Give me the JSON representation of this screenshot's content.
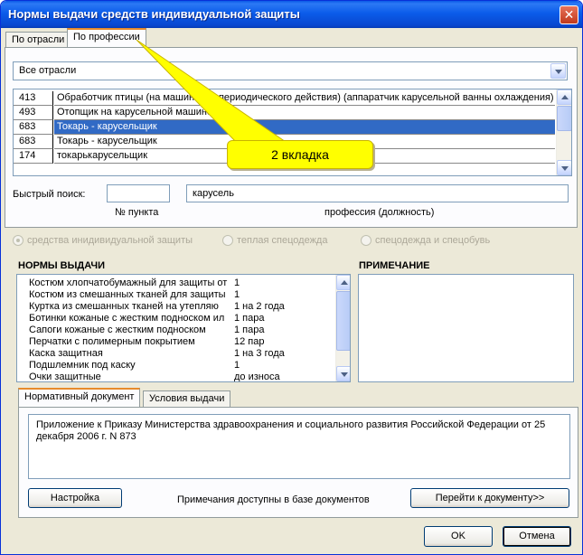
{
  "window": {
    "title": "Нормы выдачи средств индивидуальной защиты",
    "close_glyph": "✕"
  },
  "tabs": {
    "items": [
      {
        "label": "По отрасли"
      },
      {
        "label": "По профессии"
      }
    ]
  },
  "industry_select": {
    "value": "Все отрасли"
  },
  "professions": [
    {
      "code": "413",
      "name": "Обработчик птицы (на машинах непериодического действия) (аппаратчик карусельной ванны охлаждения)"
    },
    {
      "code": "493",
      "name": "Отопщик на карусельной машине"
    },
    {
      "code": "683",
      "name": "Токарь - карусельщик"
    },
    {
      "code": "683",
      "name": "Токарь - карусельщик"
    },
    {
      "code": "174",
      "name": "токарькарусельщик"
    }
  ],
  "callout": {
    "text": "2 вкладка",
    "color": "#ffff00"
  },
  "search": {
    "label": "Быстрый поиск:",
    "item_value": "",
    "profession_value": "карусель",
    "item_caption": "№ пункта",
    "profession_caption": "профессия (должность)"
  },
  "radios": [
    {
      "label": "средства инидивидуальной защиты",
      "checked": true
    },
    {
      "label": "теплая спецодежда",
      "checked": false
    },
    {
      "label": "спецодежда и спецобувь",
      "checked": false
    }
  ],
  "norms": {
    "heading": "НОРМЫ ВЫДАЧИ",
    "items": [
      {
        "item": "Костюм хлопчатобумажный для защиты от",
        "qty": "1"
      },
      {
        "item": "Костюм из смешанных тканей для защиты",
        "qty": "1"
      },
      {
        "item": "Куртка из смешанных тканей на утепляю",
        "qty": "1 на 2 года"
      },
      {
        "item": "Ботинки кожаные с жестким подноском ил",
        "qty": "1 пара"
      },
      {
        "item": "Сапоги кожаные с жестким подноском",
        "qty": "1 пара"
      },
      {
        "item": "Перчатки с полимерным покрытием",
        "qty": "12 пар"
      },
      {
        "item": "Каска защитная",
        "qty": "1 на 3 года"
      },
      {
        "item": "Подшлемник под каску",
        "qty": "1"
      },
      {
        "item": "Очки защитные",
        "qty": "до износа"
      }
    ]
  },
  "note": {
    "heading": "ПРИМЕЧАНИЕ",
    "text": ""
  },
  "doc_tabs": [
    {
      "label": "Нормативный документ"
    },
    {
      "label": "Условия выдачи"
    }
  ],
  "document": {
    "text": "Приложение к Приказу Министерства здравоохранения и социального развития Российской Федерации от 25 декабря 2006 г. N 873"
  },
  "bottom": {
    "settings_label": "Настройка",
    "notes_info": "Примечания доступны в базе документов",
    "goto_label": "Перейти к документу>>"
  },
  "buttons": {
    "ok": "OK",
    "cancel": "Отмена"
  }
}
